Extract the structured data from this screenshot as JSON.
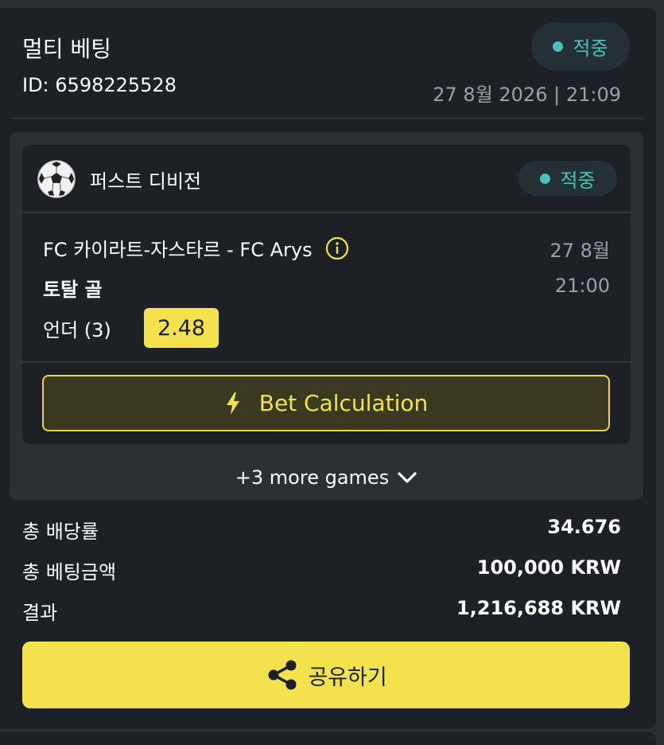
{
  "header": {
    "title": "멀티 베팅",
    "status": "적중",
    "id_text": "ID: 6598225528",
    "datetime": "27 8월 2026 | 21:09"
  },
  "bet_item": {
    "sport_icon": "soccer-ball-icon",
    "league": "퍼스트 디비전",
    "status": "적중",
    "match": "FC 카이라트-자스타르 - FC Arys",
    "date": "27 8월",
    "market": "토탈 골",
    "time": "21:00",
    "selection": "언더 (3)",
    "odds": "2.48",
    "calc_button_label": "Bet Calculation"
  },
  "more_games_label": "+3 more games",
  "summary": {
    "total_odds_label": "총 배당률",
    "total_odds_value": "34.676",
    "total_stake_label": "총 베팅금액",
    "total_stake_value": "100,000 KRW",
    "result_label": "결과",
    "result_value": "1,216,688 KRW"
  },
  "share_button_label": "공유하기",
  "colors": {
    "accent_yellow": "#f3e24e",
    "status_teal": "#49c2b8",
    "card_bg": "#1d2125",
    "panel_bg": "#2c3034"
  }
}
